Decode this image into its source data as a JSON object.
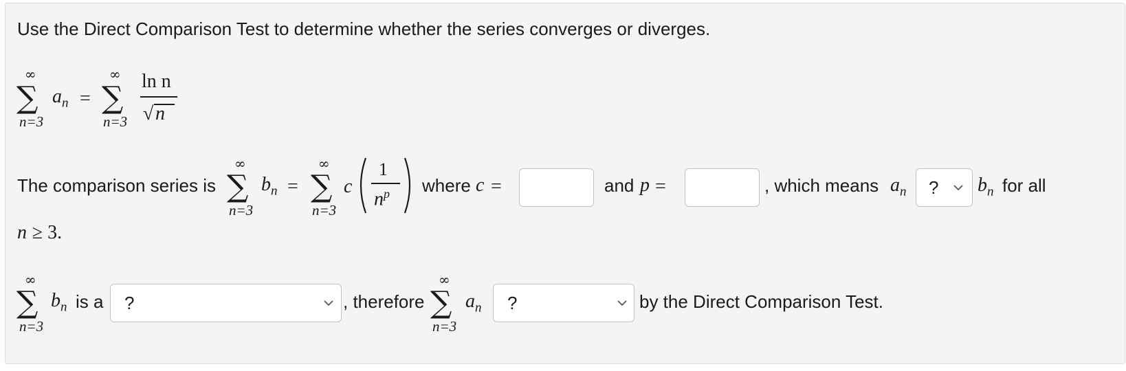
{
  "question": {
    "instruction": "Use the Direct Comparison Test to determine whether the series converges or diverges."
  },
  "series1": {
    "upper": "∞",
    "lower": "n=3",
    "an": "a",
    "sub": "n",
    "equals": "=",
    "num": "ln n",
    "den_root": "√",
    "den_var": "n"
  },
  "line2": {
    "prefix": "The comparison series is",
    "upper": "∞",
    "lower": "n=3",
    "bn": "b",
    "sub": "n",
    "equals": "=",
    "c": "c",
    "frac_num": "1",
    "frac_den": "n",
    "frac_exp": "p",
    "where": "where",
    "c_var": "c",
    "eq_c": "=",
    "and": "and",
    "p_var": "p",
    "eq_p": "=",
    "which_means": ", which means",
    "an": "a",
    "an_sub": "n",
    "compare_select_value": "?",
    "bn_after": "b",
    "bn_after_sub": "n",
    "for_all": "for all",
    "cond_var": "n",
    "cond_rel": "≥ 3."
  },
  "inputs": {
    "c_value": "",
    "p_value": ""
  },
  "line3": {
    "upper": "∞",
    "lower": "n=3",
    "bn": "b",
    "sub": "n",
    "is_a": "is a",
    "type_select_value": "?",
    "therefore": ", therefore",
    "upper2": "∞",
    "lower2": "n=3",
    "an": "a",
    "an_sub": "n",
    "result_select_value": "?",
    "suffix": "by the Direct Comparison Test."
  }
}
